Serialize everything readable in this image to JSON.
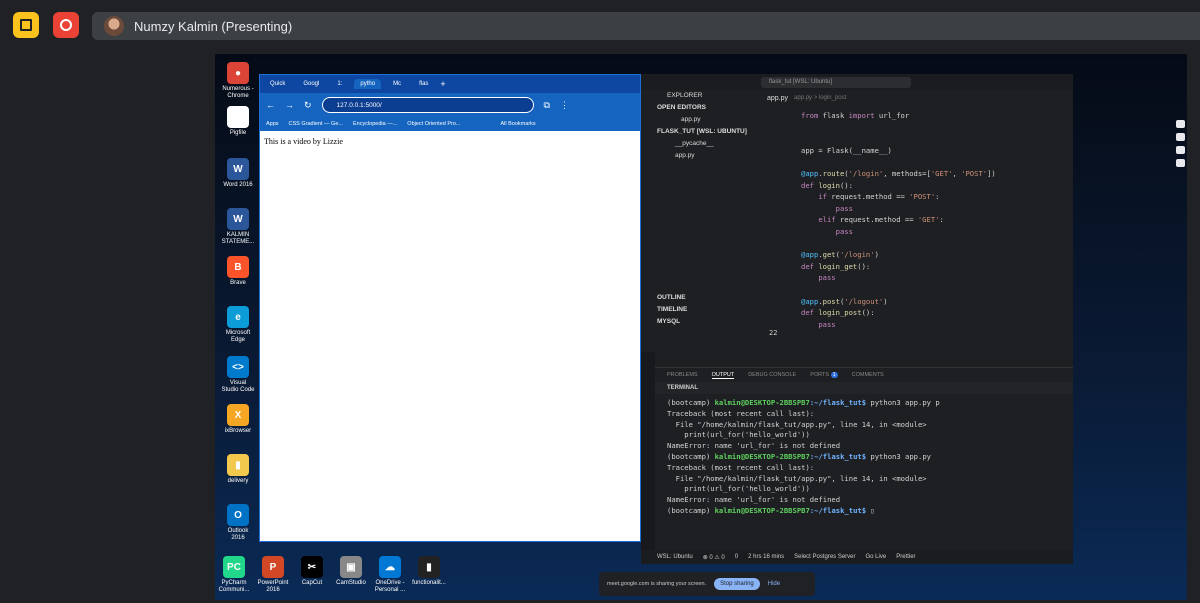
{
  "meet": {
    "presenter_name": "Numzy Kalmin (Presenting)"
  },
  "desktop_icons": [
    {
      "label": "Numerous - Chrome",
      "color": "#db4437",
      "glyph": "●"
    },
    {
      "label": "Pigfile",
      "color": "#ffffff",
      "glyph": ""
    },
    {
      "label": "Word 2016",
      "color": "#2b579a",
      "glyph": "W"
    },
    {
      "label": "KALMIN STATEME...",
      "color": "#2b579a",
      "glyph": "W"
    },
    {
      "label": "Brave",
      "color": "#fb542b",
      "glyph": "B"
    },
    {
      "label": "Microsoft Edge",
      "color": "#0c9cd8",
      "glyph": "e"
    },
    {
      "label": "Visual Studio Code",
      "color": "#007acc",
      "glyph": "<>"
    },
    {
      "label": "ixBrowser",
      "color": "#f5a623",
      "glyph": "X"
    },
    {
      "label": "delivery",
      "color": "#f2c94c",
      "glyph": "▮"
    },
    {
      "label": "Outlook 2016",
      "color": "#0072c6",
      "glyph": "O"
    }
  ],
  "taskbar_icons": [
    {
      "label": "PyCharm Communi...",
      "color": "#21d789",
      "glyph": "PC"
    },
    {
      "label": "PowerPoint 2016",
      "color": "#d24726",
      "glyph": "P"
    },
    {
      "label": "CapCut",
      "color": "#000000",
      "glyph": "✂"
    },
    {
      "label": "CamStudio",
      "color": "#888888",
      "glyph": "▣"
    },
    {
      "label": "OneDrive - Personal ...",
      "color": "#0078d4",
      "glyph": "☁"
    },
    {
      "label": "functionalit...",
      "color": "#222222",
      "glyph": "▮"
    }
  ],
  "browser": {
    "tabs": [
      "Quick",
      "Googl",
      "1:",
      "pytho",
      "Mc",
      "flas"
    ],
    "url": "127.0.0.1:5000/",
    "bookmarks": [
      "Apps",
      "CSS Gradient — Ge...",
      "Encyclopedia —...",
      "Object Oriented Pro...",
      "All Bookmarks"
    ],
    "page_text": "This is a video by Lizzie"
  },
  "vscode": {
    "search": "flask_tut [WSL: Ubuntu]",
    "editor_tab": "app.py",
    "breadcrumb": "app.py > login_post",
    "explorer_label": "EXPLORER",
    "open_editors": "OPEN EDITORS",
    "open_file": "app.py",
    "workspace": "FLASK_TUT [WSL: UBUNTU]",
    "pycache": "__pycache__",
    "file": "app.py",
    "outline": "OUTLINE",
    "timeline": "TIMELINE",
    "mysql": "MYSQL",
    "line_number": "22",
    "panel_tabs": [
      "PROBLEMS",
      "OUTPUT",
      "DEBUG CONSOLE",
      "PORTS",
      "COMMENTS"
    ],
    "ports_badge": "1",
    "terminal_label": "TERMINAL",
    "terminal_lines": [
      "Traceback (most recent call last):",
      "  File \"/home/kalmin/flask_tut/app.py\", line 14, in <module>",
      "    print(url_for('hello_world'))",
      "NameError: name 'url_for' is not defined"
    ],
    "prompt_user": "kalmin@DESKTOP-2BBSPB7",
    "prompt_path": ":~/flask_tut$",
    "prompt_env": "(bootcamp)",
    "cmd1": " python3 app.py p",
    "cmd2": " python3 app.py",
    "status": {
      "wsl": "WSL: Ubuntu",
      "errors": "⊗ 0 ⚠ 0",
      "ports": "0",
      "time": "2 hrs 16 mins",
      "db": "Select Postgres Server",
      "golive": "Go Live",
      "prettier": "Prettier"
    }
  },
  "share": {
    "notice": "meet.google.com is sharing your screen.",
    "stop": "Stop sharing",
    "hide": "Hide"
  }
}
